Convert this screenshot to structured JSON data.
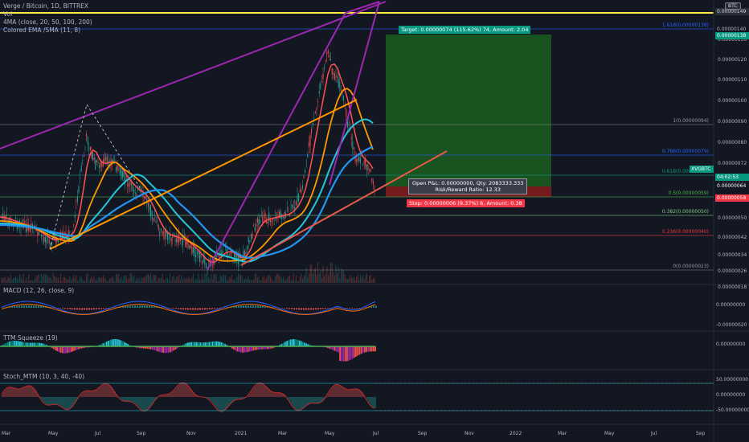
{
  "header": {
    "symbol_line": "Verge / Bitcoin, 1D, BITTREX",
    "vol_label": "Vol",
    "ma_label": "4MA (close, 20, 50, 100, 200)",
    "ema_label": "Colored EMA /SMA (11, 8)",
    "btc_badge": "BTC"
  },
  "panes": {
    "macd_label": "MACD (12, 26, close, 9)",
    "ttm_label": "TTM Squeeze (19)",
    "stoch_label": "Stoch_MTM (10, 3, 40, -40)"
  },
  "position": {
    "target_label": "Target: 0.00000074 (115.62%) 74, Amount: 2.04",
    "pnl_line1": "Open P&L: 0.00000000, Qty: 2083333.333",
    "pnl_line2": "Risk/Reward Ratio: 12.33",
    "stop_label": "Stop: 0.00000006 (9.37%) 6, Amount: 0.38"
  },
  "fib_levels": [
    {
      "label": "1.618(0.00000138)",
      "color": "#2962ff"
    },
    {
      "label": "1(0.00000094)",
      "color": "#787b86"
    },
    {
      "label": "0.786(0.00000079)",
      "color": "#2962ff"
    },
    {
      "label": "0.618(0.00000069)",
      "color": "#089981"
    },
    {
      "label": "0.5(0.00000059)",
      "color": "#4caf50"
    },
    {
      "label": "0.382(0.00000050)",
      "color": "#81c784"
    },
    {
      "label": "0.236(0.00000040)",
      "color": "#f23645"
    },
    {
      "label": "0(0.00000023)",
      "color": "#787b86"
    }
  ],
  "price_axis": {
    "labels": [
      "0.00000130",
      "0.00000120",
      "0.00000110",
      "0.00000100",
      "0.00000090",
      "0.00000080",
      "0.00000072",
      "0.00000064",
      "0.00000058",
      "0.00000050",
      "0.00000042",
      "0.00000034",
      "0.00000026",
      "0.00000018"
    ],
    "tags": [
      {
        "text": "0.00000149",
        "color": "#2a2e39",
        "fg": "#d1d4dc"
      },
      {
        "text": "0.00000140",
        "color": "#131722",
        "fg": "#b2b5be"
      },
      {
        "text": "0.00000138",
        "color": "#089981",
        "fg": "#ffffff"
      },
      {
        "text": "XVGBTC",
        "color": "#089981",
        "fg": "#ffffff"
      },
      {
        "text": "0.00000064",
        "color": "#131722",
        "fg": "#ffffff"
      },
      {
        "text": "0.00000058",
        "color": "#f23645",
        "fg": "#ffffff"
      }
    ],
    "countdown": "04:02:53",
    "macd_labels": [
      "0.00000000",
      "-0.00000020"
    ],
    "ttm_labels": [
      "0.00000000"
    ],
    "stoch_labels": [
      "50.00000000",
      "0.00000000",
      "-50.00000000"
    ]
  },
  "time_axis": [
    "Mar",
    "May",
    "Jul",
    "Sep",
    "Nov",
    "2021",
    "Mar",
    "May",
    "Jul",
    "Sep",
    "Nov",
    "2022",
    "Mar",
    "May",
    "Jul",
    "Sep"
  ],
  "colors": {
    "background": "#131722",
    "up": "#26a69a",
    "down": "#ef5350",
    "target_zone": "#1b5e20",
    "stop_zone": "#b71c1c",
    "trend_purple": "#9c27b0",
    "trend_orange": "#ff9800",
    "support_line": "#e65a4a",
    "ma_red": "#ff5252",
    "ma_orange": "#ff9800",
    "ma_cyan": "#26c6da",
    "ma_blue": "#2196f3",
    "yellow_line": "#ffeb3b"
  }
}
